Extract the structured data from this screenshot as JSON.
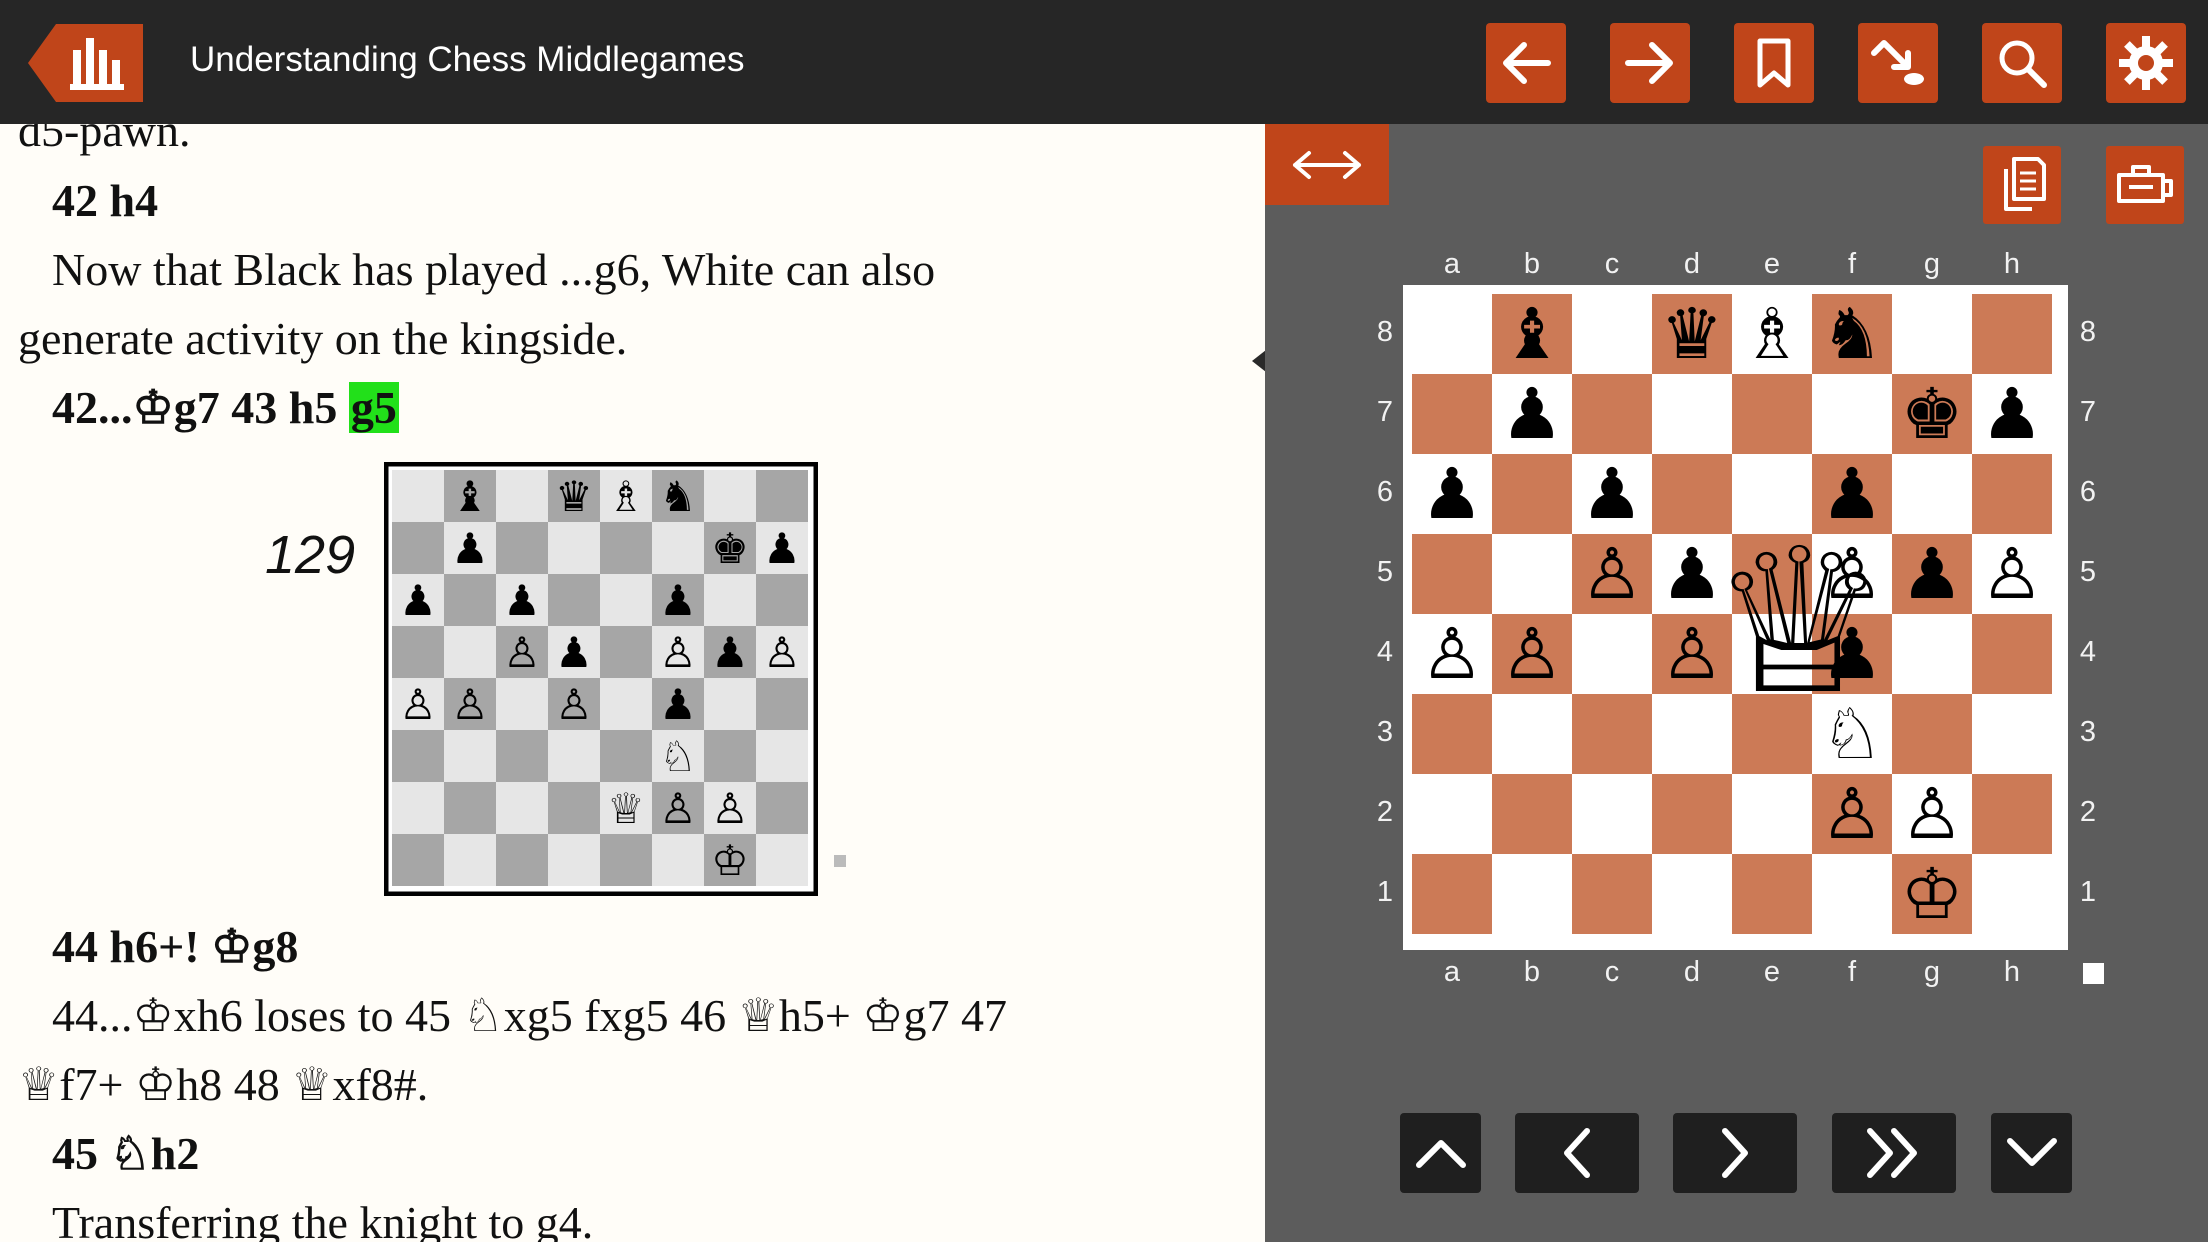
{
  "app": {
    "title": "Understanding Chess Middlegames"
  },
  "colors": {
    "accent": "#c0451a",
    "topbar": "#262626",
    "board_pane": "#5c5c5c",
    "dark_square": "#cc7a56",
    "highlight": "#22e01a"
  },
  "toolbar": {
    "icons": [
      "back-arrow-icon",
      "forward-arrow-icon",
      "bookmark-icon",
      "jump-to-move-icon",
      "search-icon",
      "gear-icon"
    ]
  },
  "book": {
    "line_0": "d5-pawn.",
    "line_1": "42 h4",
    "line_2": "Now that Black has played ...g6, White can also",
    "line_3": "generate activity on the kingside.",
    "line_4_a": "42...♔g7 43 h5 ",
    "line_4_b": "g5",
    "diagram_number": "129",
    "line_5": "44 h6+! ♔g8",
    "line_6": "44...♔xh6 loses to 45 ♘xg5 fxg5 46 ♕h5+ ♔g7 47",
    "line_7": "♕f7+ ♔h8 48 ♕xf8#.",
    "line_8": "45 ♘h2",
    "line_9": "Transferring the knight to g4."
  },
  "board": {
    "files": [
      "a",
      "b",
      "c",
      "d",
      "e",
      "f",
      "g",
      "h"
    ],
    "ranks": [
      "8",
      "7",
      "6",
      "5",
      "4",
      "3",
      "2",
      "1"
    ],
    "pieces": [
      {
        "sq": "b8",
        "glyph": "♝",
        "color": "black"
      },
      {
        "sq": "d8",
        "glyph": "♛",
        "color": "black"
      },
      {
        "sq": "e8",
        "glyph": "♗",
        "color": "white"
      },
      {
        "sq": "f8",
        "glyph": "♞",
        "color": "black"
      },
      {
        "sq": "b7",
        "glyph": "♟",
        "color": "black"
      },
      {
        "sq": "g7",
        "glyph": "♚",
        "color": "black"
      },
      {
        "sq": "h7",
        "glyph": "♟",
        "color": "black"
      },
      {
        "sq": "a6",
        "glyph": "♟",
        "color": "black"
      },
      {
        "sq": "c6",
        "glyph": "♟",
        "color": "black"
      },
      {
        "sq": "f6",
        "glyph": "♟",
        "color": "black"
      },
      {
        "sq": "c5",
        "glyph": "♙",
        "color": "white"
      },
      {
        "sq": "d5",
        "glyph": "♟",
        "color": "black"
      },
      {
        "sq": "f5",
        "glyph": "♙",
        "color": "white"
      },
      {
        "sq": "g5",
        "glyph": "♟",
        "color": "black"
      },
      {
        "sq": "h5",
        "glyph": "♙",
        "color": "white"
      },
      {
        "sq": "a4",
        "glyph": "♙",
        "color": "white"
      },
      {
        "sq": "b4",
        "glyph": "♙",
        "color": "white"
      },
      {
        "sq": "d4",
        "glyph": "♙",
        "color": "white"
      },
      {
        "sq": "f4",
        "glyph": "♟",
        "color": "black"
      },
      {
        "sq": "f3",
        "glyph": "♘",
        "color": "white"
      },
      {
        "sq": "f2",
        "glyph": "♙",
        "color": "white"
      },
      {
        "sq": "g2",
        "glyph": "♙",
        "color": "white"
      },
      {
        "sq": "g1",
        "glyph": "♔",
        "color": "white"
      }
    ],
    "dragging_piece": {
      "glyph": "♕",
      "color": "white"
    }
  },
  "mini_board": {
    "pieces": [
      {
        "sq": "b8",
        "glyph": "♝"
      },
      {
        "sq": "d8",
        "glyph": "♛"
      },
      {
        "sq": "e8",
        "glyph": "♗"
      },
      {
        "sq": "f8",
        "glyph": "♞"
      },
      {
        "sq": "b7",
        "glyph": "♟"
      },
      {
        "sq": "g7",
        "glyph": "♚"
      },
      {
        "sq": "h7",
        "glyph": "♟"
      },
      {
        "sq": "a6",
        "glyph": "♟"
      },
      {
        "sq": "c6",
        "glyph": "♟"
      },
      {
        "sq": "f6",
        "glyph": "♟"
      },
      {
        "sq": "c5",
        "glyph": "♙"
      },
      {
        "sq": "d5",
        "glyph": "♟"
      },
      {
        "sq": "f5",
        "glyph": "♙"
      },
      {
        "sq": "g5",
        "glyph": "♟"
      },
      {
        "sq": "h5",
        "glyph": "♙"
      },
      {
        "sq": "a4",
        "glyph": "♙"
      },
      {
        "sq": "b4",
        "glyph": "♙"
      },
      {
        "sq": "d4",
        "glyph": "♙"
      },
      {
        "sq": "f4",
        "glyph": "♟"
      },
      {
        "sq": "f3",
        "glyph": "♘"
      },
      {
        "sq": "e2",
        "glyph": "♕"
      },
      {
        "sq": "f2",
        "glyph": "♙"
      },
      {
        "sq": "g2",
        "glyph": "♙"
      },
      {
        "sq": "g1",
        "glyph": "♔"
      }
    ]
  },
  "nav": {
    "icons": [
      "chevron-up-icon",
      "chevron-left-icon",
      "chevron-right-icon",
      "double-chevron-right-icon",
      "chevron-down-icon"
    ]
  }
}
